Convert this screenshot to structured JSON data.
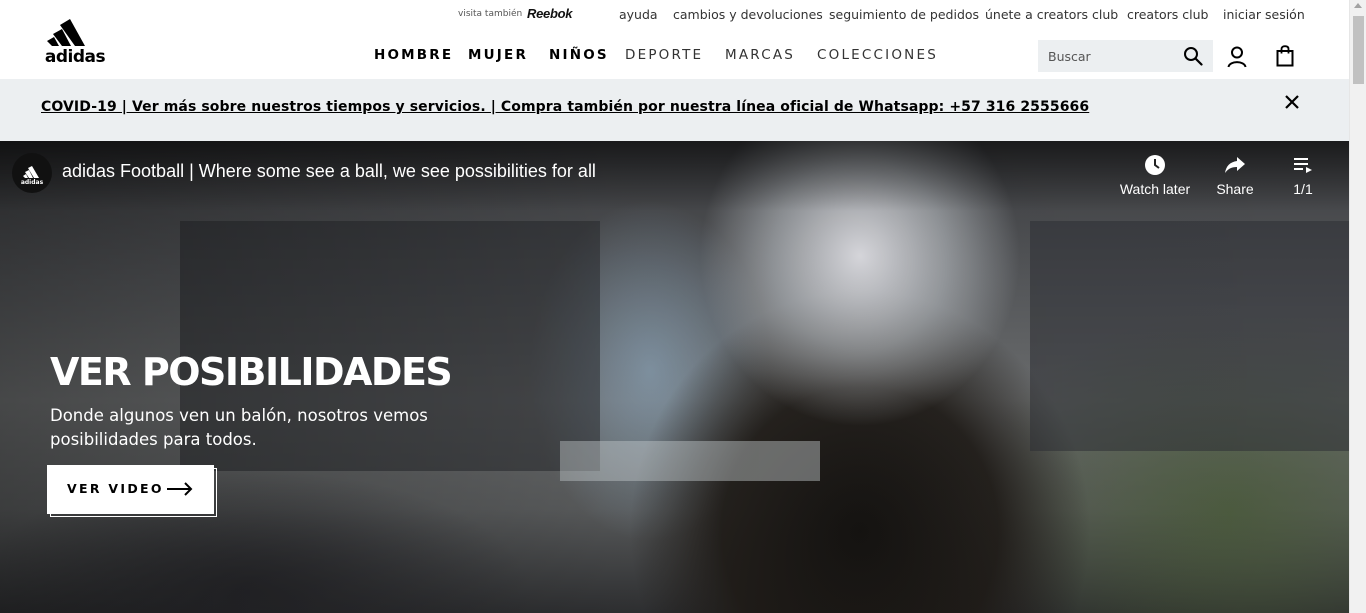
{
  "brand": {
    "logo_text": "adidas"
  },
  "utility_nav": {
    "visit_label": "visita también",
    "reebok_label": "Reebok",
    "links": [
      "ayuda",
      "cambios y devoluciones",
      "seguimiento de pedidos",
      "únete a creators club",
      "creators club",
      "iniciar sesión"
    ]
  },
  "main_nav": [
    "HOMBRE",
    "MUJER",
    "NIÑOS",
    "DEPORTE",
    "MARCAS",
    "COLECCIONES"
  ],
  "search": {
    "placeholder": "Buscar"
  },
  "icons": {
    "search": "search-icon",
    "user": "user-icon",
    "bag": "shopping-bag-icon",
    "close": "close-icon",
    "watch_later": "clock-icon",
    "share": "share-icon",
    "playlist": "playlist-icon",
    "arrow": "arrow-right-icon"
  },
  "banner": {
    "text": "COVID-19 | Ver más sobre nuestros tiempos y servicios. | Compra también por nuestra línea oficial de Whatsapp: +57 316 2555666"
  },
  "video": {
    "title": "adidas Football | Where some see a ball, we see possibilities for all",
    "watch_later_label": "Watch later",
    "share_label": "Share",
    "playlist_count": "1/1",
    "channel_avatar_text": "adidas"
  },
  "hero": {
    "title": "VER POSIBILIDADES",
    "subtitle": "Donde algunos ven un balón, nosotros vemos posibilidades para todos.",
    "cta_label": "VER VIDEO"
  },
  "colors": {
    "banner_bg": "#eceff1",
    "search_bg": "#eceff1",
    "text": "#000000",
    "hero_text": "#ffffff"
  }
}
